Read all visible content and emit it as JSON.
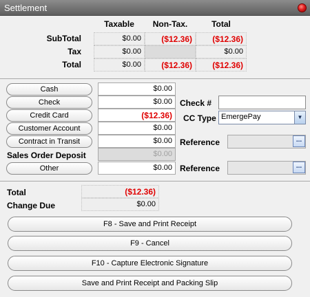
{
  "window": {
    "title": "Settlement",
    "close_icon": "close-icon"
  },
  "summary": {
    "columns": [
      "Taxable",
      "Non-Tax.",
      "Total"
    ],
    "rows": [
      {
        "label": "SubTotal",
        "taxable": "$0.00",
        "nontax": "($12.36)",
        "total": "($12.36)"
      },
      {
        "label": "Tax",
        "taxable": "$0.00",
        "nontax": "",
        "total": "$0.00"
      },
      {
        "label": "Total",
        "taxable": "$0.00",
        "nontax": "($12.36)",
        "total": "($12.36)"
      }
    ]
  },
  "payments": {
    "cash": {
      "label": "Cash",
      "amount": "$0.00"
    },
    "check": {
      "label": "Check",
      "amount": "$0.00"
    },
    "credit_card": {
      "label": "Credit Card",
      "amount": "($12.36)"
    },
    "customer_account": {
      "label": "Customer Account",
      "amount": "$0.00"
    },
    "contract_in_transit": {
      "label": "Contract in Transit",
      "amount": "$0.00"
    },
    "sales_order_deposit": {
      "label": "Sales Order Deposit",
      "amount": "$0.00"
    },
    "other": {
      "label": "Other",
      "amount": "$0.00"
    }
  },
  "details": {
    "check_number_label": "Check #",
    "check_number_value": "",
    "cc_type_label": "CC Type",
    "cc_type_value": "EmergePay",
    "reference_label_1": "Reference",
    "reference_value_1": "",
    "reference_label_2": "Reference",
    "reference_value_2": "",
    "browse_label": "..."
  },
  "totals": {
    "total_label": "Total",
    "total_value": "($12.36)",
    "change_due_label": "Change Due",
    "change_due_value": "$0.00"
  },
  "actions": {
    "f8": "F8 - Save and Print Receipt",
    "f9": "F9 - Cancel",
    "f10": "F10 - Capture Electronic Signature",
    "packing": "Save and Print Receipt and Packing Slip"
  },
  "colors": {
    "negative": "#e00000",
    "titlebar": "#6e6e6e"
  }
}
